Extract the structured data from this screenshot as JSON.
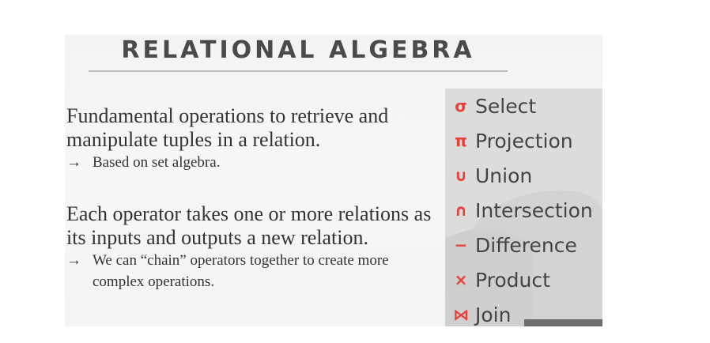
{
  "slide": {
    "title": "RELATIONAL ALGEBRA",
    "paragraph1": {
      "main": "Fundamental operations to retrieve and manipulate tuples in a relation.",
      "arrow": "→",
      "sub": "Based on set algebra."
    },
    "paragraph2": {
      "main": "Each operator takes one or more relations as its inputs and outputs a new relation.",
      "arrow": "→",
      "sub": "We can “chain” operators together to create more complex operations."
    }
  },
  "operators": [
    {
      "symbol": "σ",
      "name": "Select",
      "icon": "sigma-icon"
    },
    {
      "symbol": "π",
      "name": "Projection",
      "icon": "pi-icon"
    },
    {
      "symbol": "∪",
      "name": "Union",
      "icon": "union-icon"
    },
    {
      "symbol": "∩",
      "name": "Intersection",
      "icon": "intersection-icon"
    },
    {
      "symbol": "−",
      "name": "Difference",
      "icon": "minus-icon"
    },
    {
      "symbol": "×",
      "name": "Product",
      "icon": "times-icon"
    },
    {
      "symbol": "⋈",
      "name": "Join",
      "icon": "bowtie-icon"
    }
  ],
  "colors": {
    "accent": "#e8413a",
    "title": "#4a4a4a",
    "panel": "#dcdcdb",
    "text": "#333333"
  }
}
